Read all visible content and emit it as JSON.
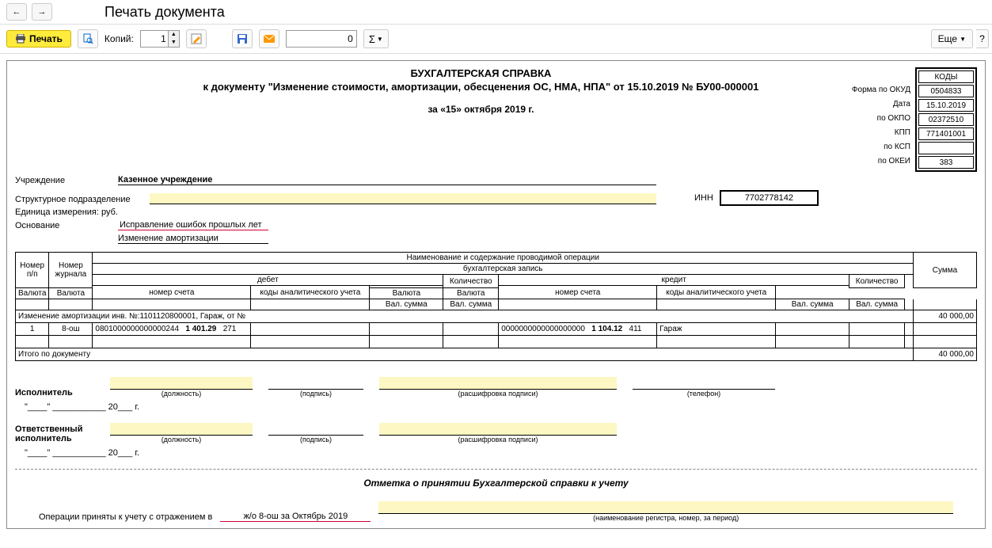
{
  "nav": {
    "back": "←",
    "forward": "→"
  },
  "pageTitle": "Печать документа",
  "toolbar": {
    "print": "Печать",
    "copies_label": "Копий:",
    "copies_value": "1",
    "num_value": "0",
    "sigma": "Σ",
    "more": "Еще"
  },
  "doc": {
    "title1": "БУХГАЛТЕРСКАЯ СПРАВКА",
    "title2": "к документу \"Изменение стоимости, амортизации, обесценения ОС, НМА, НПА\" от 15.10.2019 № БУ00-000001",
    "date_line": "за «15» октября 2019 г.",
    "inst_label": "Учреждение",
    "inst_value": "Казенное учреждение",
    "inn_label": "ИНН",
    "inn_value": "7702778142",
    "struct_label": "Структурное подразделение",
    "unit_label": "Единица измерения: руб.",
    "reason_label": "Основание",
    "reason1": "Исправление ошибок прошлых лет",
    "reason2": "Изменение амортизации",
    "codes": {
      "header": "КОДЫ",
      "okud_label": "Форма  по ОКУД",
      "okud": "0504833",
      "date_label": "Дата",
      "date": "15.10.2019",
      "okpo_label": "по ОКПО",
      "okpo": "02372510",
      "kpp_label": "КПП",
      "kpp": "771401001",
      "ksp_label": "по КСП",
      "ksp": "",
      "okei_label": "по ОКЕИ",
      "okei": "383"
    }
  },
  "mt": {
    "h_op": "Наименование и содержание проводимой операции",
    "h_entry": "бухгалтерская запись",
    "h_num": "Номер п/п",
    "h_journal": "Номер журнала",
    "h_debit": "дебет",
    "h_credit": "кредит",
    "h_sum": "Сумма",
    "h_acc": "номер счета",
    "h_anal": "коды аналитического учета",
    "h_qty": "Количество",
    "h_cur": "Валюта",
    "h_valsum": "Вал. сумма",
    "group_row": "Изменение амортизации инв. №:1101120800001, Гараж,  от  №",
    "row": {
      "num": "1",
      "journal": "8-ош",
      "d_acc": "0801000000000000244",
      "d_sub": "1 401.29",
      "d_end": "271",
      "c_acc": "0000000000000000000",
      "c_sub": "1 104.12",
      "c_end": "411",
      "c_anal": "Гараж"
    },
    "total_label": "Итого по документу",
    "sum1": "40 000,00",
    "sum_total": "40 000,00"
  },
  "sign": {
    "exec": "Исполнитель",
    "resp": "Ответственный исполнитель",
    "post": "(должность)",
    "signature": "(подпись)",
    "decode": "(расшифровка подписи)",
    "phone": "(телефон)",
    "date_tpl": "\"____\" ___________ 20___ г."
  },
  "accept": {
    "title": "Отметка о принятии Бухгалтерской справки к учету",
    "text": "Операции приняты к учету с отражением в",
    "journal": "ж/о 8-ош за Октябрь 2019",
    "cap": "(наименование регистра, номер, за период)"
  }
}
